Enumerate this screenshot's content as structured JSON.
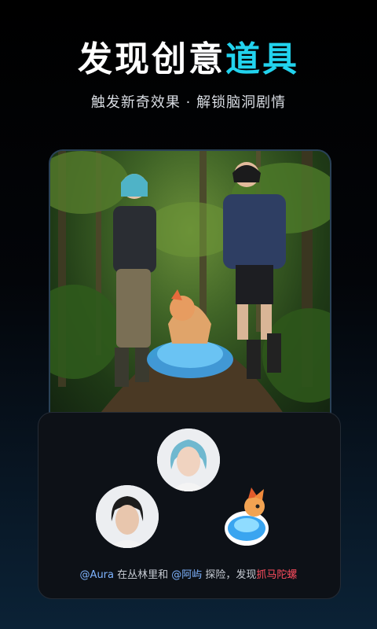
{
  "hero": {
    "title_main": "发现创意",
    "title_accent": "道具",
    "subtitle": "触发新奇效果 · 解锁脑洞剧情"
  },
  "demo": {
    "caption": {
      "user1": "@Aura",
      "text1": " 在丛林里和 ",
      "user2": "@阿屿",
      "text2": " 探险，发现",
      "highlight": "抓马陀螺"
    }
  },
  "colors": {
    "accent": "#22d3ee",
    "mention": "#7fb4ff",
    "highlight": "#ff4d5e"
  }
}
